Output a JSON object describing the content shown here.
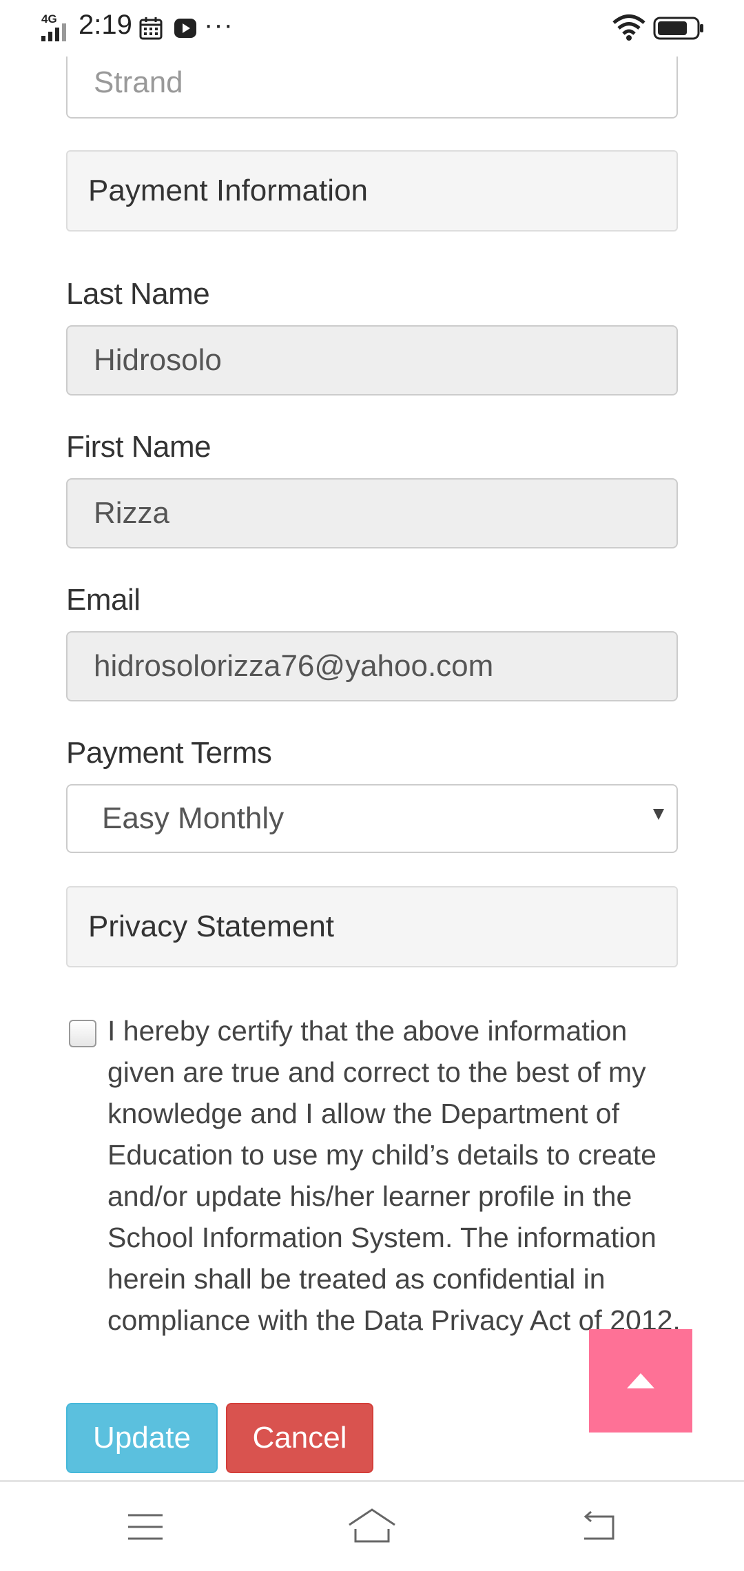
{
  "status_bar": {
    "network": "4G",
    "time": "2:19",
    "more": "···",
    "icons": [
      "signal-icon",
      "calendar-icon",
      "youtube-icon",
      "wifi-icon",
      "battery-icon"
    ]
  },
  "form": {
    "strand_placeholder": "Strand",
    "payment_heading": "Payment Information",
    "last_name": {
      "label": "Last Name",
      "value": "Hidrosolo"
    },
    "first_name": {
      "label": "First Name",
      "value": "Rizza"
    },
    "email": {
      "label": "Email",
      "value": "hidrosolorizza76@yahoo.com"
    },
    "payment_terms": {
      "label": "Payment Terms",
      "selected": "Easy Monthly"
    },
    "privacy_heading": "Privacy Statement",
    "certify_text": "I hereby certify that the above information given are true and correct to the best of my knowledge and I allow the Department of Education to use my child’s details to create and/or update his/her learner profile in the School Information System. The information herein shall be treated as confidential in compliance with the Data Privacy Act of 2012.",
    "update_label": "Update",
    "cancel_label": "Cancel"
  },
  "colors": {
    "update_button": "#5bc0de",
    "cancel_button": "#d9534f",
    "scroll_top_button": "#fe7196"
  },
  "nav_bar": {
    "icons": [
      "menu-icon",
      "home-icon",
      "back-icon"
    ]
  }
}
